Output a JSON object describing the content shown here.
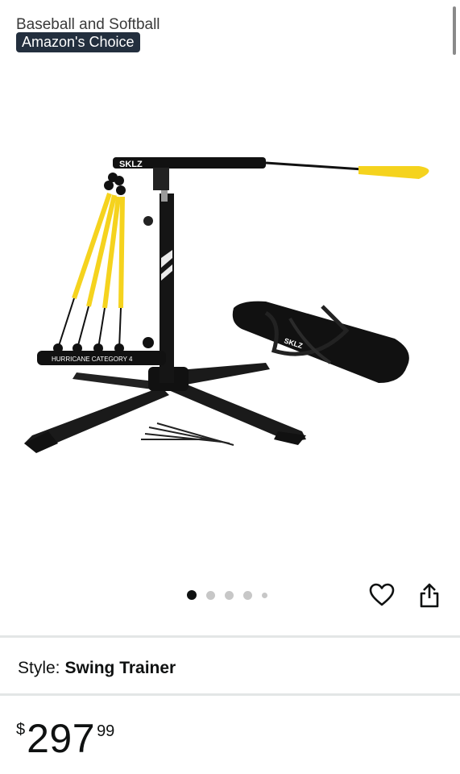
{
  "product": {
    "title_fragment": "Baseball and Softball",
    "badge": "Amazon's Choice",
    "image_brand": "SKLZ",
    "image_model": "HURRICANE CATEGORY 4",
    "carousel_total": 5,
    "carousel_active": 1
  },
  "actions": {
    "favorite_icon": "heart-icon",
    "share_icon": "share-icon"
  },
  "style": {
    "label": "Style:",
    "value": "Swing Trainer"
  },
  "price": {
    "symbol": "$",
    "whole": "297",
    "fraction": "99"
  },
  "colors": {
    "badge_bg": "#232f3e",
    "accent_yellow": "#f5d31e"
  }
}
